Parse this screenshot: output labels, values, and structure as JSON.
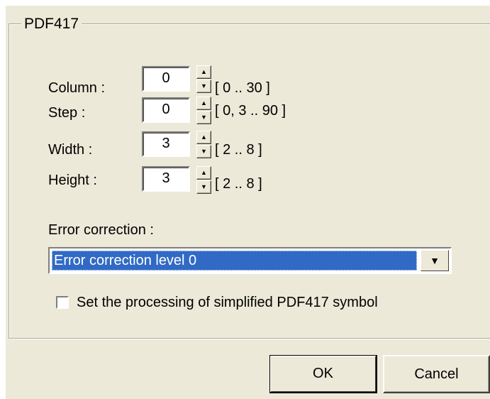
{
  "group": {
    "title": "PDF417"
  },
  "fields": [
    {
      "label": "Column :",
      "value": "0",
      "range": "[ 0 .. 30 ]"
    },
    {
      "label": "Step :",
      "value": "0",
      "range": "[ 0, 3 .. 90 ]"
    },
    {
      "label": "Width :",
      "value": "3",
      "range": "[ 2 .. 8 ]"
    },
    {
      "label": "Height :",
      "value": "3",
      "range": "[ 2 .. 8 ]"
    }
  ],
  "error_correction": {
    "label": "Error correction :",
    "selected": "Error correction level 0"
  },
  "simplified": {
    "label": "Set the processing of simplified PDF417 symbol",
    "checked": false
  },
  "buttons": {
    "ok": "OK",
    "cancel": "Cancel"
  },
  "icons": {
    "spin_up": "spin-up-icon",
    "spin_down": "spin-down-icon",
    "dropdown": "dropdown-arrow-icon"
  },
  "colors": {
    "dialog_background": "#ECE9D8",
    "selection": "#316AC5"
  }
}
